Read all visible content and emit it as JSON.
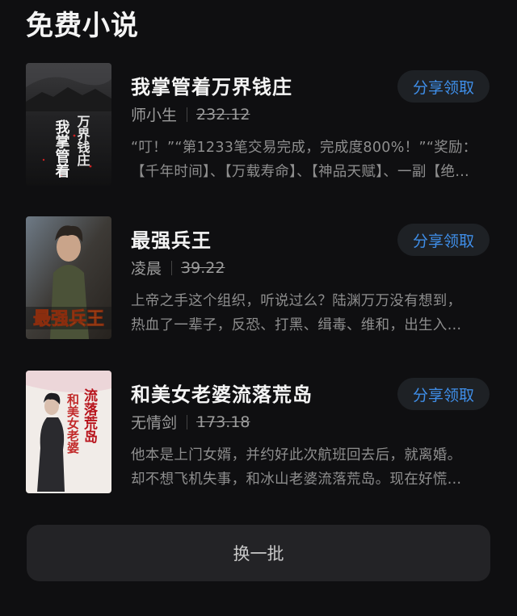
{
  "section": {
    "title": "免费小说"
  },
  "books": [
    {
      "title": "我掌管着万界钱庄",
      "author": "师小生",
      "price": "232.12",
      "desc_line1": "“叮！”“第1233笔交易完成，完成度800%！”“奖励：",
      "desc_line2": "【千年时间】、【万载寿命】、【神品天赋】、一副【绝…",
      "share_label": "分享领取",
      "cover_text_main": "我掌管着",
      "cover_text_side": "万界钱庄"
    },
    {
      "title": "最强兵王",
      "author": "凌晨",
      "price": "39.22",
      "desc_line1": "上帝之手这个组织，听说过么？陆渊万万没有想到，",
      "desc_line2": "热血了一辈子，反恐、打黑、缉毒、维和，出生入…",
      "share_label": "分享领取",
      "cover_text_main": "最强兵王"
    },
    {
      "title": "和美女老婆流落荒岛",
      "author": "无情剑",
      "price": "173.18",
      "desc_line1": "他本是上门女婿，并约好此次航班回去后，就离婚。",
      "desc_line2": "却不想飞机失事，和冰山老婆流落荒岛。现在好慌…",
      "share_label": "分享领取",
      "cover_text_col1": "和美女老婆",
      "cover_text_col2": "流落荒岛"
    }
  ],
  "refresh": {
    "label": "换一批"
  },
  "colors": {
    "background": "#0f0f11",
    "accent": "#3f8ee8",
    "button_bg": "#1e2125"
  }
}
